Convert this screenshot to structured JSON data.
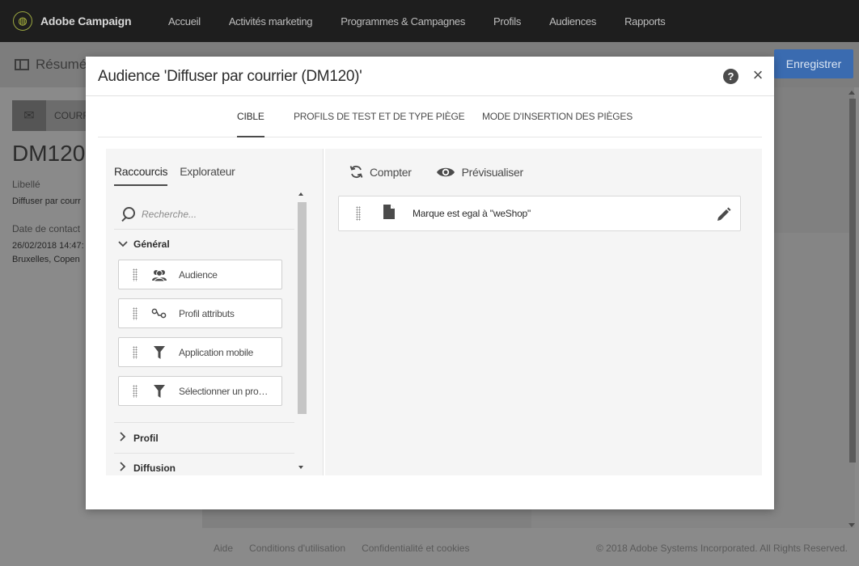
{
  "app": {
    "name": "Adobe Campaign",
    "nav": [
      "Accueil",
      "Activités marketing",
      "Programmes & Campagnes",
      "Profils",
      "Audiences",
      "Rapports"
    ]
  },
  "background": {
    "page_title": "Résumé",
    "save_label": "Enregistrer",
    "card_label": "COURR",
    "code": "DM120",
    "libelle_label": "Libellé",
    "libelle_value": "Diffuser par courr",
    "contact_label": "Date de contact",
    "contact_date": "26/02/2018 14:47:",
    "contact_zone": "Bruxelles, Copen"
  },
  "footer": {
    "links": [
      "Aide",
      "Conditions d'utilisation",
      "Confidentialité et cookies"
    ],
    "copyright": "© 2018 Adobe Systems Incorporated. All Rights Reserved."
  },
  "modal": {
    "title": "Audience 'Diffuser par courrier (DM120)'",
    "help": "?",
    "close": "×",
    "tabs": [
      "CIBLE",
      "PROFILS DE TEST ET DE TYPE PIÈGE",
      "MODE D'INSERTION DES PIÈGES"
    ],
    "active_tab": "CIBLE"
  },
  "shortcuts": {
    "tabs": [
      "Raccourcis",
      "Explorateur"
    ],
    "search_placeholder": "Recherche...",
    "sections": [
      {
        "label": "Général",
        "expanded": true,
        "chevron": "chevron-down-icon"
      },
      {
        "label": "Profil",
        "expanded": false,
        "chevron": "chevron-right-icon"
      },
      {
        "label": "Diffusion",
        "expanded": false,
        "chevron": "chevron-right-icon"
      }
    ],
    "items": [
      {
        "label": "Audience",
        "icon": "audience-icon"
      },
      {
        "label": "Profil attributs",
        "icon": "attributes-icon"
      },
      {
        "label": "Application mobile",
        "icon": "filter-icon"
      },
      {
        "label": "Sélectionner un pro…",
        "icon": "filter-icon"
      }
    ]
  },
  "workspace": {
    "count_label": "Compter",
    "preview_label": "Prévisualiser",
    "rule_text": "Marque est egal à \"weShop\""
  },
  "colors": {
    "topbar": "#1e1e1e",
    "accent": "#3a6bb0",
    "logo": "#9aa640"
  }
}
